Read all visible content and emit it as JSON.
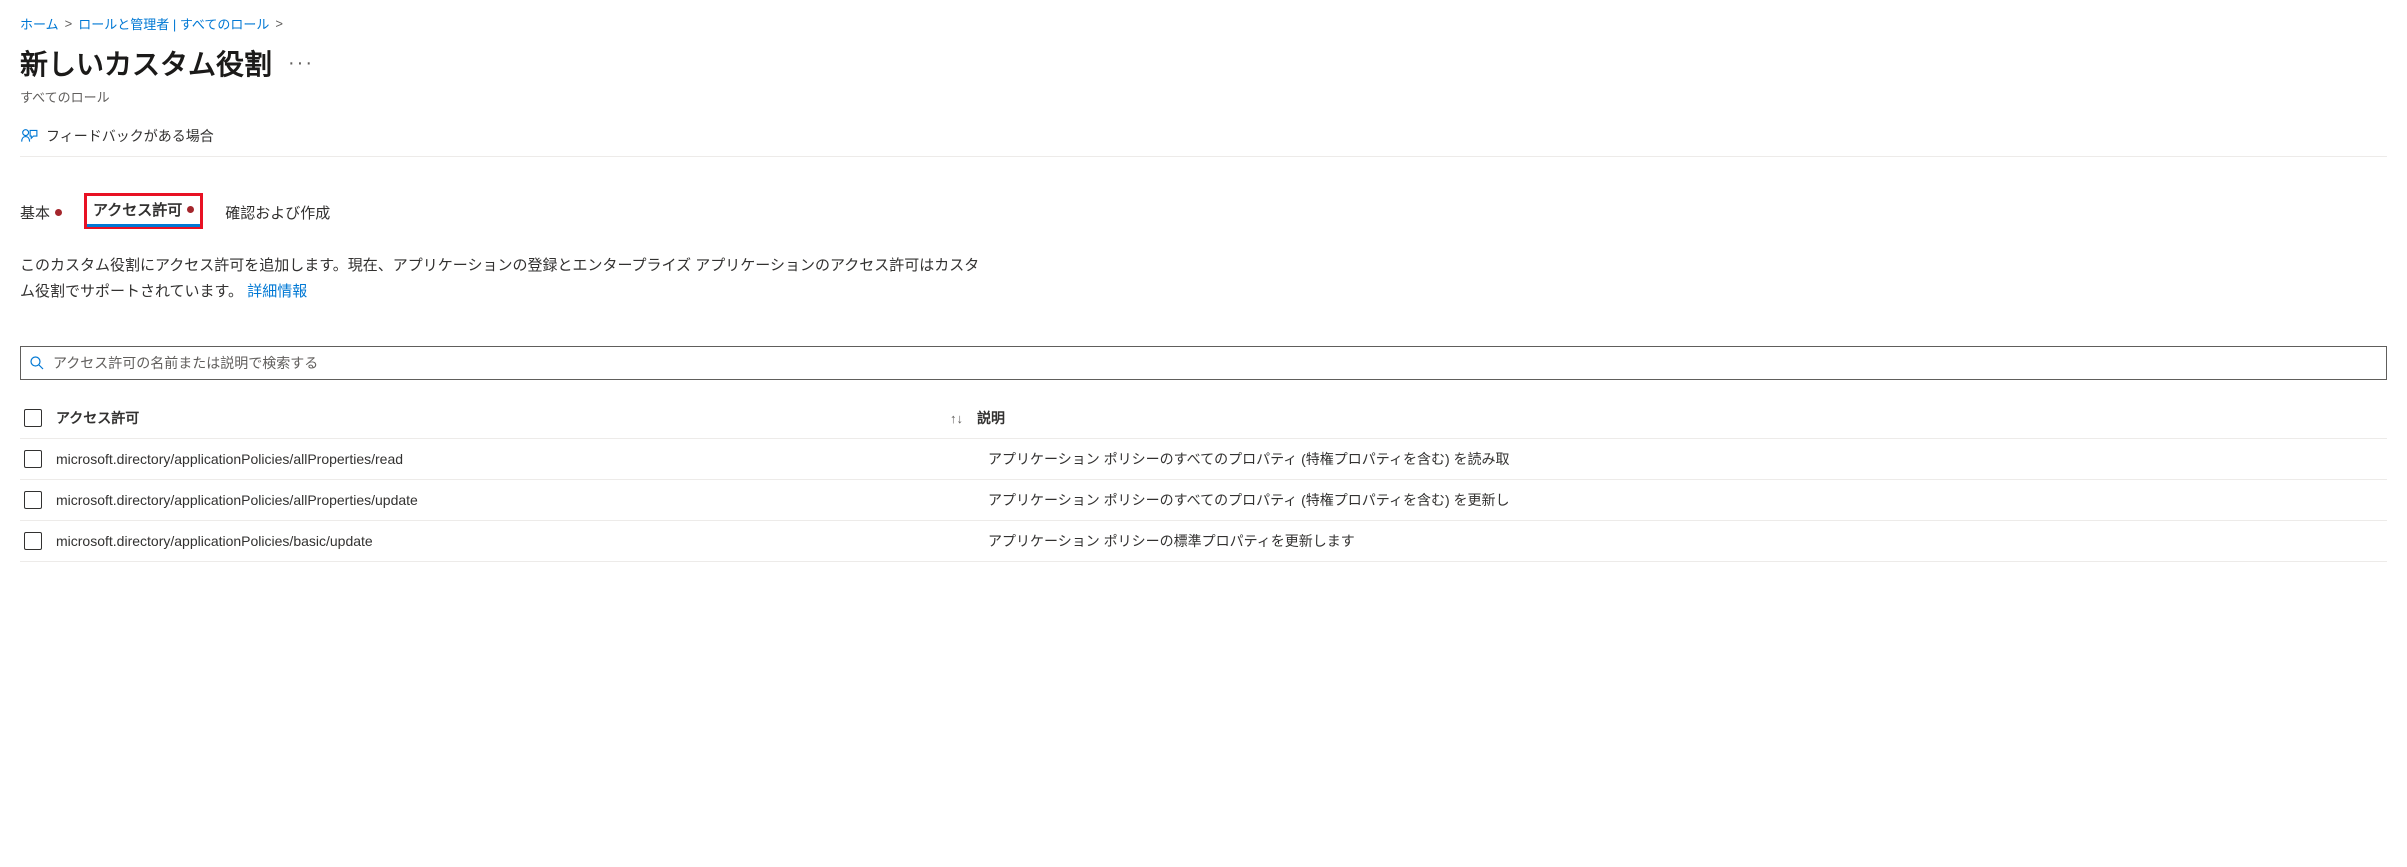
{
  "breadcrumb": {
    "home": "ホーム",
    "roles": "ロールと管理者 | すべてのロール"
  },
  "page": {
    "title": "新しいカスタム役割",
    "subtitle": "すべてのロール",
    "ellipsis": "···"
  },
  "commands": {
    "feedback": "フィードバックがある場合"
  },
  "tabs": {
    "basic": "基本",
    "permissions": "アクセス許可",
    "review": "確認および作成"
  },
  "description": {
    "line1": "このカスタム役割にアクセス許可を追加します。現在、アプリケーションの登録とエンタープライズ アプリケーションのアクセス許可はカスタ",
    "line2": "ム役割でサポートされています。",
    "link": "詳細情報"
  },
  "search": {
    "placeholder": "アクセス許可の名前または説明で検索する"
  },
  "table": {
    "header_permission": "アクセス許可",
    "header_sort": "↑↓",
    "header_description": "説明",
    "rows": [
      {
        "perm": "microsoft.directory/applicationPolicies/allProperties/read",
        "desc": "アプリケーション ポリシーのすべてのプロパティ (特権プロパティを含む) を読み取"
      },
      {
        "perm": "microsoft.directory/applicationPolicies/allProperties/update",
        "desc": "アプリケーション ポリシーのすべてのプロパティ (特権プロパティを含む) を更新し"
      },
      {
        "perm": "microsoft.directory/applicationPolicies/basic/update",
        "desc": "アプリケーション ポリシーの標準プロパティを更新します"
      }
    ]
  }
}
